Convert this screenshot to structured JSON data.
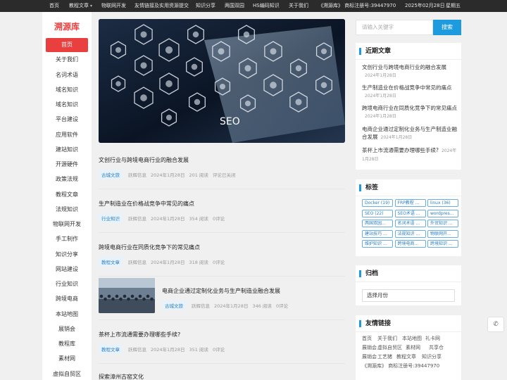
{
  "topnav": {
    "items": [
      "首页",
      "教程文章",
      "物联网开发",
      "友情链接及实用资源提交",
      "知识分享",
      "两国双园",
      "HS编码知识",
      "关于我们",
      "《溯源库》 商标注册号:39447970"
    ],
    "date": "2025年02月28日",
    "weekday": "星期五"
  },
  "sidebar": {
    "logo": "溯源库",
    "items": [
      "首页",
      "关于我们",
      "名词术语",
      "域名知识",
      "域名知识",
      "平台建设",
      "应用软件",
      "建站知识",
      "开源硬件",
      "政策法规",
      "教程文章",
      "法规知识",
      "物联网开发",
      "手工制作",
      "知识分享",
      "网站建设",
      "行业知识",
      "跨境电商",
      "本站地图",
      "展销会",
      "教程库",
      "素材网",
      "虚拟自贸区"
    ]
  },
  "hero": {
    "text": "SEO"
  },
  "articles": [
    {
      "title": "文创行业与跨境电商行业的融合发展",
      "category": "古城文旅",
      "author": "跃辉信息",
      "date": "2024年1月28日",
      "reads": "201 阅读",
      "comments": "评论已关闭"
    },
    {
      "title": "生产制造业在价格战竞争中常见的痛点",
      "category": "行业知识",
      "author": "跃辉信息",
      "date": "2024年1月28日",
      "reads": "354 阅读",
      "comments": "0评论"
    },
    {
      "title": "跨境电商行业在同质化竞争下的常见痛点",
      "category": "教程文章",
      "author": "跃辉信息",
      "date": "2024年1月28日",
      "reads": "318 阅读",
      "comments": "0评论"
    },
    {
      "title": "电商企业通过定制化业务与生产制造业融合发展",
      "category": "古城文旅",
      "author": "跃辉信息",
      "date": "2024年1月28日",
      "reads": "346 阅读",
      "comments": "0评论"
    },
    {
      "title": "茶杯上市流通需要办理哪些手续?",
      "category": "教程文章",
      "author": "跃辉信息",
      "date": "2024年1月28日",
      "reads": "351 阅读",
      "comments": "0评论"
    },
    {
      "title": "探索漳州古窑文化"
    }
  ],
  "search": {
    "placeholder": "请输入关键字",
    "button": "搜索"
  },
  "recent": {
    "title": "近期文章",
    "items": [
      {
        "title": "文创行业与跨境电商行业的融合发展",
        "date": "2024年1月28日"
      },
      {
        "title": "生产制造业在价格战竞争中常见的痛点",
        "date": "2024年1月28日"
      },
      {
        "title": "跨境电商行业在同质化竞争下的常见痛点",
        "date": "2024年1月28日"
      },
      {
        "title": "电商企业通过定制化业务与生产制造业融合发展",
        "date": "2024年1月28日"
      },
      {
        "title": "茶杯上市流通需要办理哪些手续?",
        "date": "2024年1月28日"
      }
    ]
  },
  "tags": {
    "title": "标签",
    "items": [
      "Docker (19)",
      "FRP教程 ...",
      "linux (36)",
      "SEO (22)",
      "SEO术语 ...",
      "wordpres...",
      "两国双园...",
      "名词术语 ...",
      "外贸知识 ...",
      "建站技巧 ...",
      "法规知识 ...",
      "物联网开...",
      "维护知识 ...",
      "跨境电商...",
      "跨境知识 ..."
    ]
  },
  "archive": {
    "title": "归档",
    "select": "选择月份"
  },
  "links": {
    "title": "友情链接",
    "items": [
      "首页",
      "关于我们",
      "本站地图",
      "礼卡网",
      "展销会",
      "虚拟自贸区",
      "素材网",
      "共享仓",
      "展销会",
      "工艺猪",
      "教程文章",
      "知识分享",
      "《溯源库》 商标注册号:39447970"
    ]
  },
  "colors": {
    "accent": "#e9403f",
    "primary": "#1e9bdf",
    "topbar": "#2b2b2b"
  },
  "float": {
    "icon": "phone-icon"
  }
}
